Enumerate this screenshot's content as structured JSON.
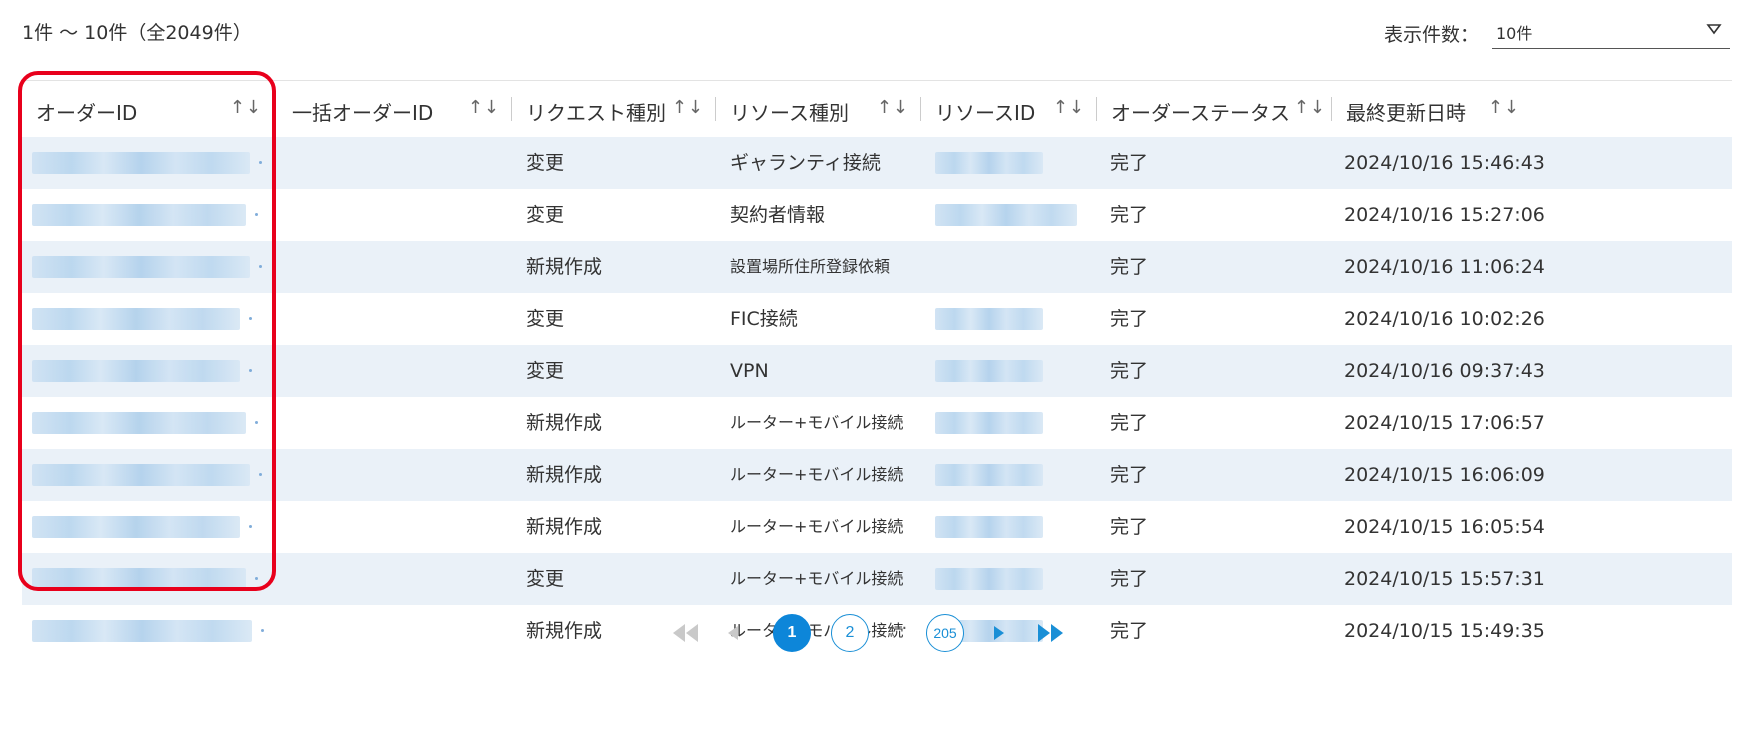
{
  "header": {
    "count_text": "1件 ～ 10件（全2049件）",
    "per_page_label": "表示件数：",
    "per_page_value": "10件"
  },
  "table": {
    "columns": [
      {
        "label": "オーダーID",
        "sort": "↑↓"
      },
      {
        "label": "一括オーダーID",
        "sort": "↑↓"
      },
      {
        "label": "リクエスト種別",
        "sort": "↑↓"
      },
      {
        "label": "リソース種別",
        "sort": "↑↓"
      },
      {
        "label": "リソースID",
        "sort": "↑↓"
      },
      {
        "label": "オーダーステータス",
        "sort": "↑↓"
      },
      {
        "label": "最終更新日時",
        "sort": "↑↓"
      }
    ],
    "rows": [
      {
        "request_type": "変更",
        "resource_type": "ギャランティ接続",
        "status": "完了",
        "updated": "2024/10/16 15:46:43"
      },
      {
        "request_type": "変更",
        "resource_type": "契約者情報",
        "status": "完了",
        "updated": "2024/10/16 15:27:06"
      },
      {
        "request_type": "新規作成",
        "resource_type": "設置場所住所登録依頼",
        "status": "完了",
        "updated": "2024/10/16 11:06:24"
      },
      {
        "request_type": "変更",
        "resource_type": "FIC接続",
        "status": "完了",
        "updated": "2024/10/16 10:02:26"
      },
      {
        "request_type": "変更",
        "resource_type": "VPN",
        "status": "完了",
        "updated": "2024/10/16 09:37:43"
      },
      {
        "request_type": "新規作成",
        "resource_type": "ルーター+モバイル接続",
        "status": "完了",
        "updated": "2024/10/15 17:06:57"
      },
      {
        "request_type": "新規作成",
        "resource_type": "ルーター+モバイル接続",
        "status": "完了",
        "updated": "2024/10/15 16:06:09"
      },
      {
        "request_type": "新規作成",
        "resource_type": "ルーター+モバイル接続",
        "status": "完了",
        "updated": "2024/10/15 16:05:54"
      },
      {
        "request_type": "変更",
        "resource_type": "ルーター+モバイル接続",
        "status": "完了",
        "updated": "2024/10/15 15:57:31"
      },
      {
        "request_type": "新規作成",
        "resource_type": "ルーター+モバイル接続",
        "status": "完了",
        "updated": "2024/10/15 15:49:35"
      }
    ]
  },
  "pagination": {
    "pages": [
      "1",
      "2",
      "205"
    ],
    "current": "1",
    "ellipsis": "···"
  },
  "colors": {
    "highlight": "#e8001c",
    "accent": "#0d86d9",
    "row_alt": "#eaf1f8"
  }
}
